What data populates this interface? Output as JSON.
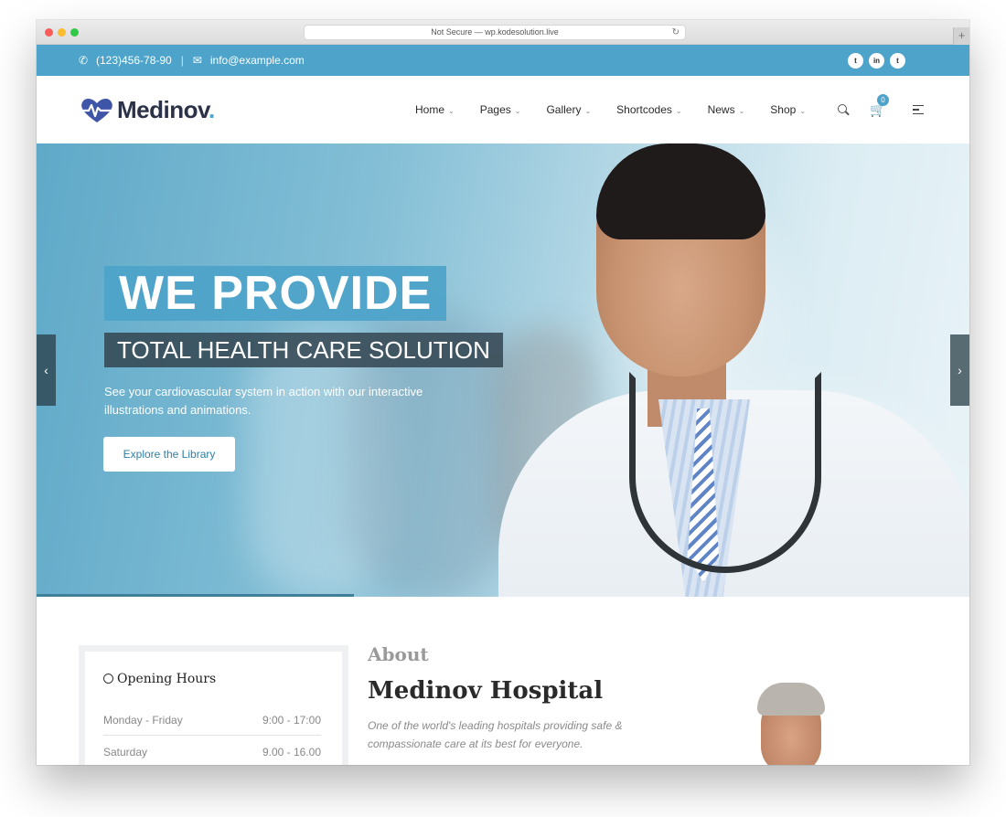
{
  "browser": {
    "address": "Not Secure — wp.kodesolution.live",
    "reload_icon": "reload-icon",
    "new_tab_icon": "plus-icon"
  },
  "topbar": {
    "phone": "(123)456-78-90",
    "email": "info@example.com",
    "social": [
      "t",
      "in",
      "t"
    ]
  },
  "logo": {
    "name": "Medinov",
    "dot": "."
  },
  "menu": [
    {
      "label": "Home"
    },
    {
      "label": "Pages"
    },
    {
      "label": "Gallery"
    },
    {
      "label": "Shortcodes"
    },
    {
      "label": "News"
    },
    {
      "label": "Shop"
    }
  ],
  "cart": {
    "count": "0"
  },
  "hero": {
    "title_line1": "WE PROVIDE",
    "title_line2": "TOTAL HEALTH CARE SOLUTION",
    "description": "See your cardiovascular system in action with our interactive illustrations and animations.",
    "button_label": "Explore the Library",
    "prev_arrow": "‹",
    "next_arrow": "›"
  },
  "hours": {
    "title": "Opening Hours",
    "rows": [
      {
        "day": "Monday - Friday",
        "time": "9:00 - 17:00"
      },
      {
        "day": "Saturday",
        "time": "9.00 - 16.00"
      }
    ]
  },
  "about": {
    "small_heading": "About",
    "title": "Medinov Hospital",
    "description": "One of the world's leading hospitals providing safe & compassionate care at its best for everyone."
  },
  "colors": {
    "accent": "#4da3c9",
    "dark": "#2b3147"
  }
}
